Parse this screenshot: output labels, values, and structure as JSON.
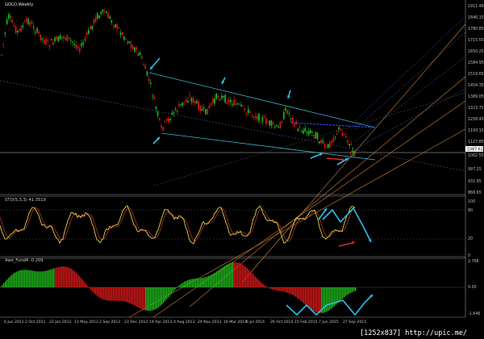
{
  "window": {
    "symbol_label": "GOLD,Weekly"
  },
  "colors": {
    "bg": "#000000",
    "bull": "#22c11f",
    "bear": "#e01a1a",
    "grid": "#444444",
    "channel": "#3fb6cf",
    "fib": "#c8813b",
    "arrow": "#29c1ea",
    "osc_main": "#ffe84a",
    "osc_signal": "#c0392b"
  },
  "price_axis": {
    "ticks": [
      "1911.48",
      "1846.15",
      "1780.85",
      "1715.55",
      "1650.25",
      "1584.95",
      "1519.65",
      "1454.35",
      "1389.05",
      "1323.75",
      "1258.45",
      "1193.15",
      "1127.85",
      "1062.55",
      "997.25",
      "931.95",
      "866.65"
    ],
    "current_price": "1087.61"
  },
  "stoch_panel": {
    "label": "STO(5,3,3) 41.3519",
    "ticks": [
      "100",
      "80",
      "20",
      "0"
    ]
  },
  "ao_panel": {
    "label": "Awe_Fund4 -0.209",
    "ticks": [
      "2.766",
      "0.00",
      "-1.646"
    ]
  },
  "time_axis": {
    "labels": [
      "6 Jun 2011",
      "2 Oct 2011",
      "22 Jan 2012",
      "13 May 2012",
      "2 Sep 2012",
      "23 Dec 2012",
      "14 Apr 2013",
      "4 Aug 2013",
      "24 Nov 2013",
      "16 Mar 2014",
      "6 Jul 2014",
      "26 Oct 2014",
      "15 Feb 2015",
      "7 Jun 2015",
      "27 Sep 2015"
    ]
  },
  "watermark": "[1252x837] http://upic.me/"
}
